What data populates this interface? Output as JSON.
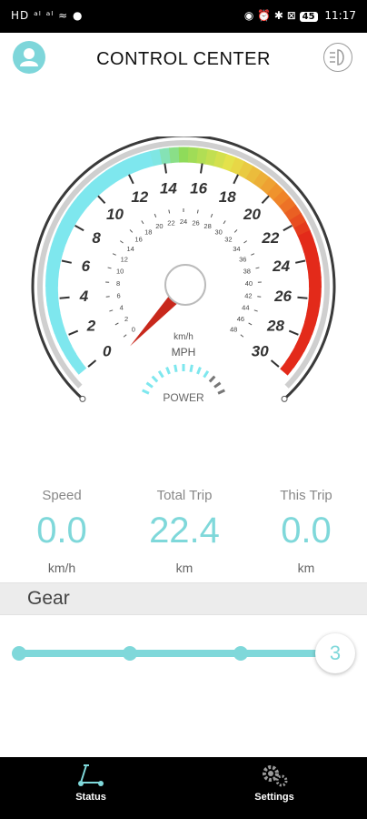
{
  "status_bar": {
    "left": "HD ᵃˡ ᵃˡ ≈ ●",
    "battery": "45",
    "time": "11:17"
  },
  "header": {
    "title": "CONTROL CENTER"
  },
  "gauge": {
    "mph_labels": [
      "0",
      "2",
      "4",
      "6",
      "8",
      "10",
      "12",
      "14",
      "16",
      "18",
      "20",
      "22",
      "24",
      "26",
      "28",
      "30"
    ],
    "kmh_labels": [
      "0",
      "2",
      "4",
      "6",
      "8",
      "10",
      "12",
      "14",
      "16",
      "18",
      "20",
      "22",
      "24",
      "26",
      "28",
      "30",
      "32",
      "34",
      "36",
      "38",
      "40",
      "42",
      "44",
      "46",
      "48"
    ],
    "unit_kmh": "km/h",
    "unit_mph": "MPH",
    "power_label": "POWER",
    "needle_value_mph": 0,
    "colors": {
      "cyan": "#7ee7ee",
      "green": "#8fdb5a",
      "yellow": "#e7e24a",
      "orange": "#f08a2a",
      "red": "#e32a1a"
    }
  },
  "stats": [
    {
      "label": "Speed",
      "value": "0.0",
      "unit": "km/h"
    },
    {
      "label": "Total Trip",
      "value": "22.4",
      "unit": "km"
    },
    {
      "label": "This Trip",
      "value": "0.0",
      "unit": "km"
    }
  ],
  "gear": {
    "label": "Gear",
    "value": "3",
    "level": 3,
    "max_level": 3
  },
  "nav": {
    "status": "Status",
    "settings": "Settings"
  }
}
